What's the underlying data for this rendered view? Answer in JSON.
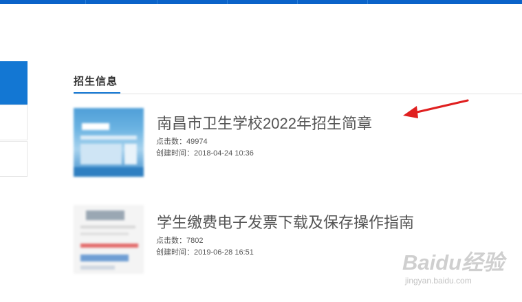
{
  "section": {
    "title": "招生信息"
  },
  "items": [
    {
      "title": "南昌市卫生学校2022年招生简章",
      "clicks_label": "点击数：",
      "clicks": "49974",
      "created_label": "创建时间：",
      "created": "2018-04-24 10:36"
    },
    {
      "title": "学生缴费电子发票下载及保存操作指南",
      "clicks_label": "点击数：",
      "clicks": "7802",
      "created_label": "创建时间：",
      "created": "2019-06-28 16:51"
    }
  ],
  "annotation": {
    "arrow_color": "#e02020"
  },
  "watermark": {
    "logo": "Baidu经验",
    "url": "jingyan.baidu.com"
  },
  "colors": {
    "brand_blue": "#1377d3",
    "nav_blue": "#0a63c9"
  }
}
